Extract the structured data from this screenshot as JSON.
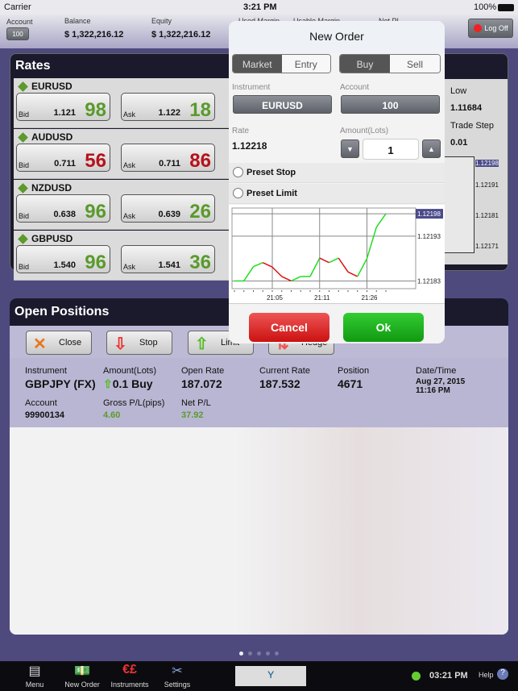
{
  "status_bar": {
    "carrier": "Carrier",
    "time": "3:21 PM",
    "battery": "100%"
  },
  "account_bar": {
    "account_label": "Account",
    "account_value": "100",
    "balance_label": "Balance",
    "balance": "$ 1,322,216.12",
    "equity_label": "Equity",
    "equity": "$ 1,322,216.12",
    "used_margin_label": "Used Margin",
    "usable_margin_label": "Usable Margin",
    "net_pl_label": "Net PL",
    "logoff": "Log Off"
  },
  "rates": {
    "title": "Rates",
    "items": [
      {
        "name": "EURUSD",
        "bid_label": "Bid",
        "bid_prefix": "1.121",
        "bid_big": "98",
        "ask_label": "Ask",
        "ask_prefix": "1.122",
        "ask_big": "18",
        "direction": "up"
      },
      {
        "name": "AUDUSD",
        "bid_label": "Bid",
        "bid_prefix": "0.711",
        "bid_big": "56",
        "ask_label": "Ask",
        "ask_prefix": "0.711",
        "ask_big": "86",
        "direction": "down"
      },
      {
        "name": "NZDUSD",
        "bid_label": "Bid",
        "bid_prefix": "0.638",
        "bid_big": "96",
        "ask_label": "Ask",
        "ask_prefix": "0.639",
        "ask_big": "26",
        "direction": "up"
      },
      {
        "name": "GBPUSD",
        "bid_label": "Bid",
        "bid_prefix": "1.540",
        "bid_big": "96",
        "ask_label": "Ask",
        "ask_prefix": "1.541",
        "ask_big": "36",
        "direction": "up"
      }
    ],
    "side": {
      "low_label": "Low",
      "low": "1.11684",
      "step_label": "Trade Step",
      "step": "0.01",
      "chart_ticks": [
        "1.12198",
        "1.12191",
        "1.12181",
        "1.12171"
      ]
    }
  },
  "open_positions": {
    "title": "Open Positions",
    "buttons": [
      "Close",
      "Stop",
      "Limit",
      "Hedge"
    ],
    "columns": {
      "instrument_label": "Instrument",
      "instrument": "GBPJPY (FX)",
      "amount_label": "Amount(Lots)",
      "amount": "0.1 Buy",
      "open_rate_label": "Open Rate",
      "open_rate": "187.072",
      "current_rate_label": "Current Rate",
      "current_rate": "187.532",
      "position_label": "Position",
      "position": "4671",
      "datetime_label": "Date/Time",
      "date": "Aug 27, 2015",
      "time": "11:16 PM",
      "account_label": "Account",
      "account": "99900134",
      "gross_label": "Gross P/L(pips)",
      "gross": "4.60",
      "net_label": "Net P/L",
      "net": "37.92"
    }
  },
  "dialog": {
    "title": "New Order",
    "order_types": [
      "Market",
      "Entry"
    ],
    "selected_type": "Market",
    "sides": [
      "Buy",
      "Sell"
    ],
    "selected_side": "Buy",
    "instrument_label": "Instrument",
    "instrument": "EURUSD",
    "account_label": "Account",
    "account": "100",
    "rate_label": "Rate",
    "rate": "1.12218",
    "amount_label": "Amount(Lots)",
    "amount": "1",
    "preset_stop": "Preset Stop",
    "preset_limit": "Preset Limit",
    "cancel": "Cancel",
    "ok": "Ok"
  },
  "chart_data": {
    "type": "line",
    "values": [
      1.12183,
      1.12183,
      1.121862,
      1.121871,
      1.121861,
      1.12184,
      1.12183,
      1.12184,
      1.12184,
      1.121881,
      1.121871,
      1.121881,
      1.12185,
      1.12184,
      1.12188,
      1.12195,
      1.12198
    ],
    "x_ticks": [
      {
        "index": 4,
        "label": "21:05"
      },
      {
        "index": 9,
        "label": "21:11"
      },
      {
        "index": 14,
        "label": "21:26"
      }
    ],
    "y_ticks": [
      "1.12198",
      "1.12193",
      "1.12183"
    ],
    "current": "1.12198",
    "ylim": [
      1.12182,
      1.122
    ],
    "up_color": "#22dd22",
    "down_color": "#dd1111",
    "grid": true
  },
  "tab_bar": {
    "items": [
      "Menu",
      "New Order",
      "Instruments",
      "Settings"
    ],
    "clock": "03:21 PM",
    "help": "Help"
  },
  "page_dots": {
    "count": 5,
    "active": 0
  }
}
